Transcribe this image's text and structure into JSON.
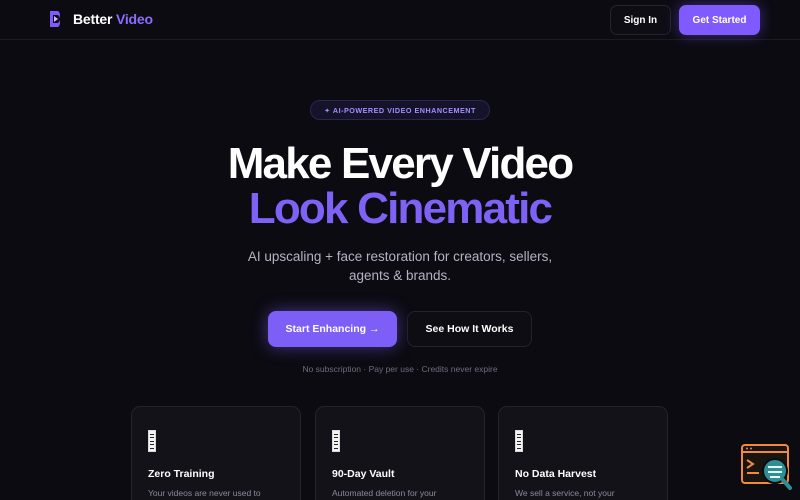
{
  "navbar": {
    "brand_name": "Better",
    "brand_accent": "Video",
    "signin_label": "Sign In",
    "get_started_label": "Get Started"
  },
  "hero": {
    "badge": "✦ AI-POWERED VIDEO ENHANCEMENT",
    "headline_line1": "Make Every Video",
    "headline_line2": "Look Cinematic",
    "subtitle": "AI upscaling + face restoration for creators, sellers, agents & brands.",
    "cta_primary": "Start Enhancing →",
    "cta_secondary": "See How It Works",
    "fineprint": "No subscription · Pay per use · Credits never expire"
  },
  "features": [
    {
      "icon": "document-icon",
      "title": "Zero Training",
      "description": "Your videos are never used to"
    },
    {
      "icon": "document-icon",
      "title": "90-Day Vault",
      "description": "Automated deletion for your"
    },
    {
      "icon": "document-icon",
      "title": "No Data Harvest",
      "description": "We sell a service, not your"
    }
  ],
  "colors": {
    "background": "#0c0b12",
    "accent": "#7f5bff",
    "headline_accent": "#7e62f6",
    "widget_orange": "#f08a3c",
    "widget_teal": "#2d8f94"
  }
}
